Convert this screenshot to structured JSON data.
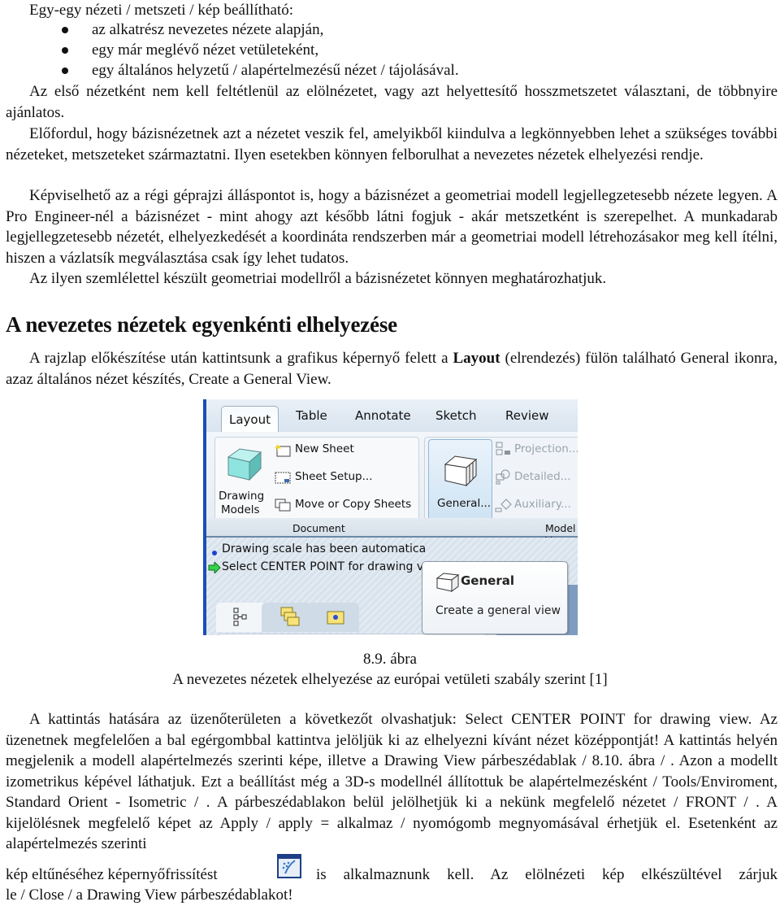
{
  "intro": {
    "lead": "Egy-egy nézeti / metszeti / kép beállítható:",
    "bullets": [
      "az alkatrész nevezetes nézete alapján,",
      "egy már meglévő nézet vetületeként,",
      "egy általános helyzetű / alapértelmezésű nézet / tájolásával."
    ]
  },
  "paragraphs": {
    "p1": "Az első nézetként nem kell feltétlenül az elölnézetet, vagy azt helyettesítő hosszmetszetet választani, de többnyire ajánlatos.",
    "p2": "Előfordul, hogy bázisnézetnek azt a nézetet veszik fel, amelyikből kiindulva a legkönnyebben lehet a szükséges további nézeteket, metszeteket származtatni. Ilyen esetekben könnyen felborulhat a nevezetes nézetek elhelyezési rendje.",
    "p3": "Képviselhető az a régi géprajzi álláspontot is, hogy a bázisnézet a geometriai modell legjellegzetesebb nézete legyen. A Pro Engineer-nél a bázisnézet - mint ahogy azt később látni fogjuk - akár metszetként is szerepelhet. A munkadarab legjellegzetesebb nézetét, elhelyezkedését a koordináta rendszerben már a geometriai modell létrehozásakor meg kell ítélni, hiszen a vázlatsík megválasztása csak így lehet tudatos.",
    "p4": "Az ilyen szemlélettel készült geometriai modellről a bázisnézetet könnyen meghatározhatjuk."
  },
  "section": {
    "heading": "A nevezetes nézetek egyenkénti elhelyezése",
    "p5_before": "A rajzlap előkészítése után kattintsunk a grafikus képernyő felett a ",
    "p5_bold": "Layout",
    "p5_after": " (elrendezés) fülön található General ikonra, azaz általános nézet készítés, Create a General View."
  },
  "figure": {
    "tabs": [
      "Layout",
      "Table",
      "Annotate",
      "Sketch",
      "Review"
    ],
    "active_tab": "Layout",
    "document_group": {
      "label": "Document",
      "drawing_models_label_1": "Drawing",
      "drawing_models_label_2": "Models",
      "items": [
        "New Sheet",
        "Sheet Setup...",
        "Move or Copy Sheets"
      ]
    },
    "model_views_group": {
      "label": "Model V",
      "general_button": "General...",
      "items": [
        "Projection...",
        "Detailed...",
        "Auxiliary..."
      ]
    },
    "messages": [
      "Drawing scale has been automatica",
      "Select CENTER POINT for drawing v"
    ],
    "tooltip": {
      "title": "General",
      "description": "Create a general view"
    },
    "tree_label": "Drawing Tree",
    "caption_number": "8.9. ábra",
    "caption_text": "A nevezetes nézetek elhelyezése az európai vetületi szabály szerint [1]"
  },
  "after": {
    "p6": "A kattintás hatására az üzenőterületen a következőt olvashatjuk: Select CENTER POINT for drawing view. Az üzenetnek megfelelően a bal egérgombbal kattintva jelöljük ki az elhelyezni kívánt nézet középpontját! A kattintás helyén megjelenik a modell alapértelmezés szerinti képe, illetve a Drawing View párbeszédablak / 8.10. ábra / . Azon a modellt izometrikus képével láthatjuk. Ezt a beállítást még a 3D-s modellnél állítottuk be alapértelmezésként / Tools/Enviroment, Standard Orient - Isometric / . A párbeszédablakon belül jelölhetjük ki a nekünk megfelelő nézetet / FRONT / . A kijelölésnek megfelelő képet az Apply / apply = alkalmaz / nyomógomb megnyomásával érhetjük el. Esetenként az alapértelmezés szerinti",
    "p7_before": "kép eltűnéséhez képernyőfrissítést",
    "p7_after": "is alkalmaznunk kell. Az elölnézeti kép elkészültével zárjuk le / Close / a Drawing View párbeszédablakot!"
  }
}
